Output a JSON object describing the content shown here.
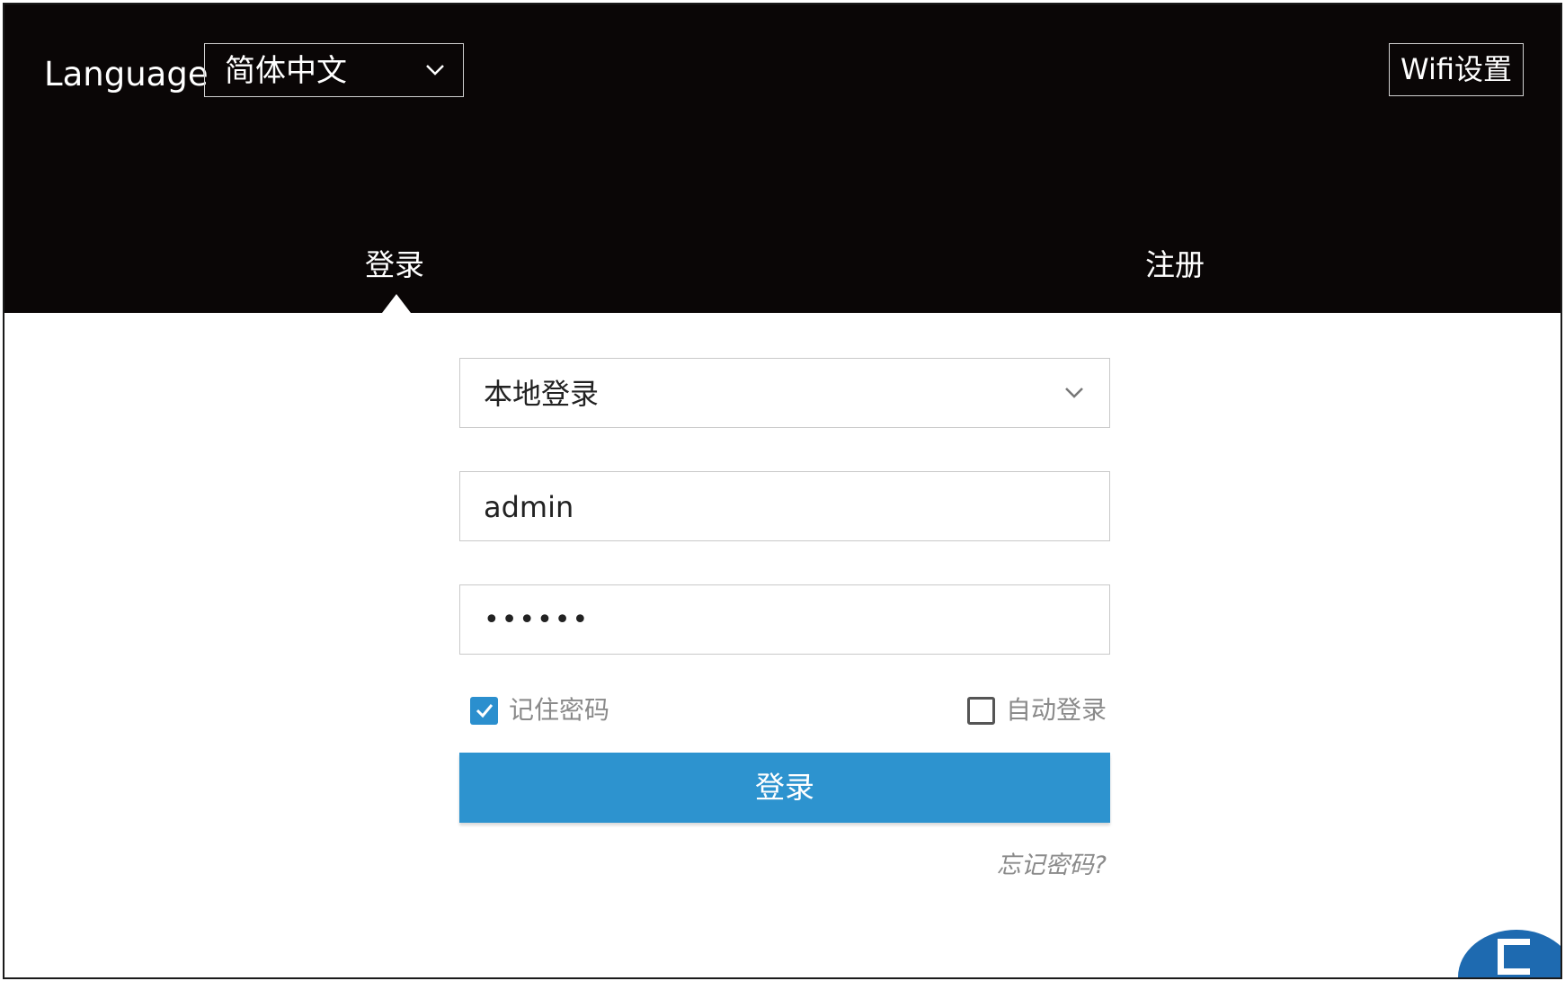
{
  "header": {
    "language_label": "Language",
    "language_value": "简体中文",
    "wifi_button": "Wifi设置"
  },
  "tabs": [
    {
      "label": "登录",
      "active": true
    },
    {
      "label": "注册",
      "active": false
    }
  ],
  "form": {
    "login_type": "本地登录",
    "username": "admin",
    "password_mask": "••••••",
    "remember_label": "记住密码",
    "remember_checked": true,
    "auto_login_label": "自动登录",
    "auto_login_checked": false,
    "submit_label": "登录",
    "forgot_label": "忘记密码?"
  },
  "colors": {
    "header_bg": "#0a0606",
    "accent": "#2d93cf",
    "muted_text": "#8a8a8a"
  },
  "icons": [
    "chevron-down-icon",
    "checkmark-icon"
  ]
}
